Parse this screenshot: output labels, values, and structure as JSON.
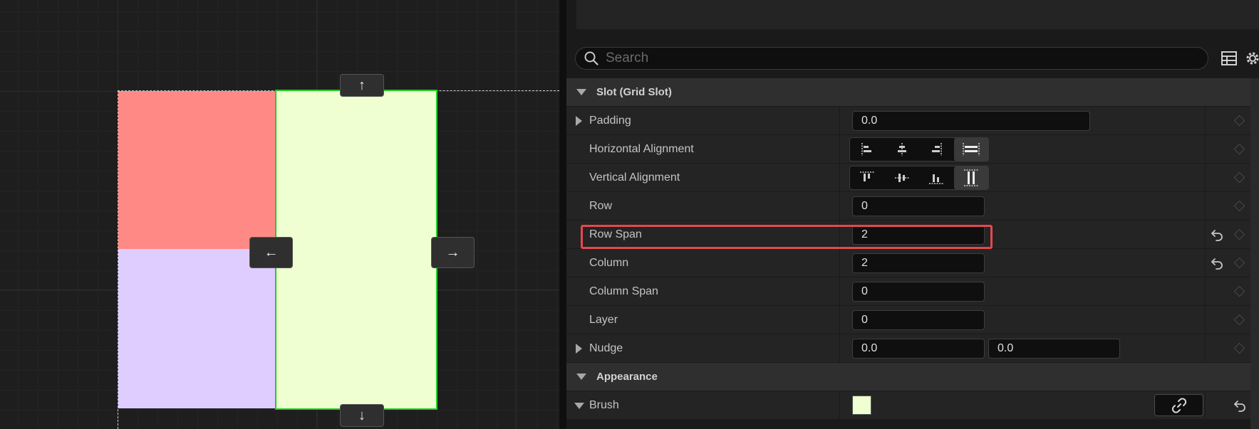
{
  "canvas": {
    "cells": [
      {
        "name": "grid-cell-red",
        "color": "#ff8a85"
      },
      {
        "name": "grid-cell-lavender",
        "color": "#dfcdff"
      },
      {
        "name": "grid-cell-yellow-green",
        "color": "#efffd1"
      }
    ],
    "selection_color": "#22cc22",
    "handles": {
      "up": "↑",
      "down": "↓",
      "left": "←",
      "right": "→"
    }
  },
  "details": {
    "search": {
      "placeholder": "Search"
    },
    "toolbar": {
      "table_icon": "table-view-icon",
      "settings_icon": "settings-gear-icon"
    },
    "sections": {
      "slot": {
        "title": "Slot (Grid Slot)"
      },
      "appearance": {
        "title": "Appearance"
      }
    },
    "properties": {
      "padding": {
        "label": "Padding",
        "value": "0.0"
      },
      "horizontal_alignment": {
        "label": "Horizontal Alignment",
        "selected": "fill"
      },
      "vertical_alignment": {
        "label": "Vertical Alignment",
        "selected": "fill"
      },
      "row": {
        "label": "Row",
        "value": "0"
      },
      "row_span": {
        "label": "Row Span",
        "value": "2"
      },
      "column": {
        "label": "Column",
        "value": "2"
      },
      "column_span": {
        "label": "Column Span",
        "value": "0"
      },
      "layer": {
        "label": "Layer",
        "value": "0"
      },
      "nudge": {
        "label": "Nudge",
        "x": "0.0",
        "y": "0.0"
      },
      "brush": {
        "label": "Brush",
        "color": "#efffd1"
      }
    },
    "highlight_color": "#e5484d"
  }
}
